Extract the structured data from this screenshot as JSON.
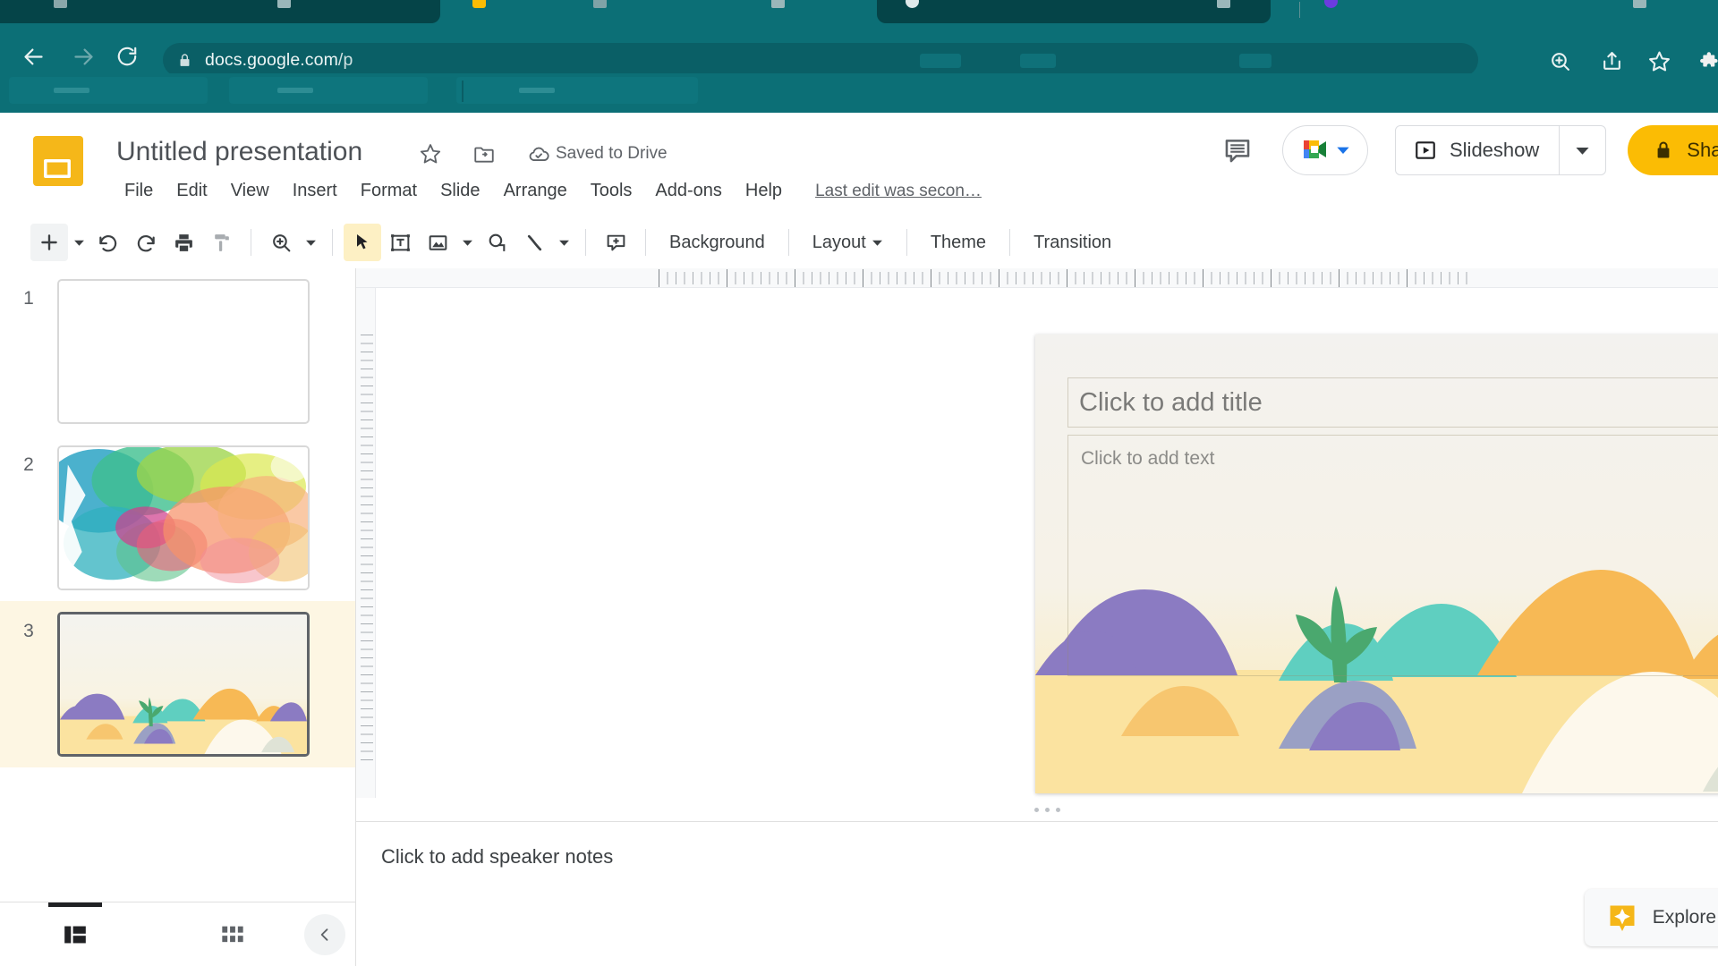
{
  "browser": {
    "back_icon": "arrow-left-icon",
    "forward_icon": "arrow-right-icon",
    "reload_icon": "reload-icon",
    "lock_icon": "lock-icon",
    "url_strong": "docs.google.com",
    "url_dim": "/p",
    "zoom_icon": "zoom-in-icon",
    "share_icon": "share-icon",
    "bookmark_icon": "star-icon",
    "extensions_icon": "puzzle-icon",
    "chrome_color": "#0c6f76",
    "tab_active_color": "#054448"
  },
  "header": {
    "logo_icon": "google-slides-logo",
    "title": "Untitled presentation",
    "star_icon": "star-outline-icon",
    "move_icon": "move-to-folder-icon",
    "cloud_icon": "cloud-saved-icon",
    "saved_status": "Saved to Drive",
    "last_edit": "Last edit was secon…",
    "comment_icon": "comment-icon",
    "meet_icon": "google-meet-icon",
    "meet_caret_icon": "caret-down-icon",
    "slideshow_icon": "play-box-icon",
    "slideshow_label": "Slideshow",
    "slideshow_caret_icon": "caret-down-icon",
    "share_lock_icon": "lock-icon",
    "share_label": "Share",
    "share_color": "#fbbc04"
  },
  "menubar": {
    "items": [
      {
        "label": "File"
      },
      {
        "label": "Edit"
      },
      {
        "label": "View"
      },
      {
        "label": "Insert"
      },
      {
        "label": "Format"
      },
      {
        "label": "Slide"
      },
      {
        "label": "Arrange"
      },
      {
        "label": "Tools"
      },
      {
        "label": "Add-ons"
      },
      {
        "label": "Help"
      }
    ]
  },
  "toolbar": {
    "new_slide_icon": "plus-icon",
    "new_slide_caret_icon": "caret-down-icon",
    "undo_icon": "undo-icon",
    "redo_icon": "redo-icon",
    "print_icon": "print-icon",
    "paint_format_icon": "paint-format-icon",
    "zoom_icon": "zoom-in-icon",
    "zoom_caret_icon": "caret-down-icon",
    "select_icon": "cursor-arrow-icon",
    "textbox_icon": "text-box-icon",
    "image_icon": "image-icon",
    "image_caret_icon": "caret-down-icon",
    "shape_icon": "shape-icon",
    "line_icon": "line-icon",
    "line_caret_icon": "caret-down-icon",
    "comment_icon": "add-comment-icon",
    "background_label": "Background",
    "layout_label": "Layout",
    "layout_caret_icon": "caret-down-icon",
    "theme_label": "Theme",
    "transition_label": "Transition"
  },
  "filmstrip": {
    "slides": [
      {
        "number": "1",
        "kind": "blank",
        "selected": false
      },
      {
        "number": "2",
        "kind": "watercolor",
        "selected": false
      },
      {
        "number": "3",
        "kind": "dunes",
        "selected": true
      }
    ],
    "film_view_icon": "filmstrip-view-icon",
    "grid_view_icon": "grid-view-icon",
    "collapse_icon": "chevron-left-icon"
  },
  "canvas": {
    "title_placeholder": "Click to add title",
    "body_placeholder": "Click to add text",
    "theme_colors": {
      "sand": "#fbe3a0",
      "purple": "#8b7bc2",
      "teal": "#5fcfc0",
      "orange": "#f7b955",
      "cream": "#fdf8ec",
      "plant_green": "#4aa86e"
    }
  },
  "notes": {
    "placeholder": "Click to add speaker notes"
  },
  "explore": {
    "icon": "explore-sparkle-icon",
    "label": "Explore"
  }
}
